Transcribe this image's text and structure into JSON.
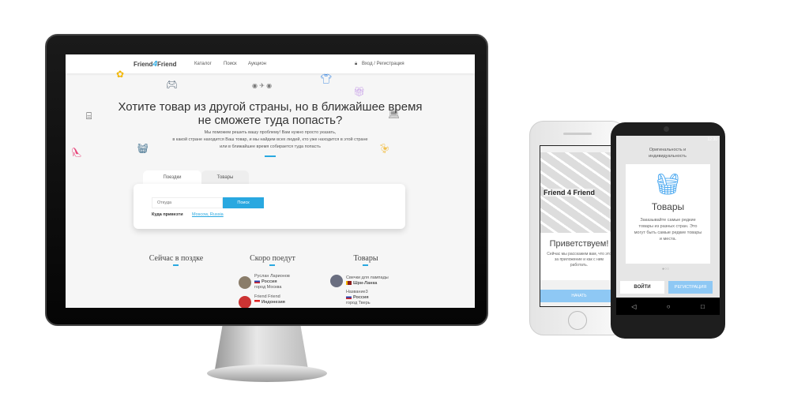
{
  "site": {
    "logo": {
      "left": "Friend",
      "mid": "4",
      "right": "Friend"
    },
    "nav": [
      "Каталог",
      "Поиск",
      "Аукцион"
    ],
    "login": "Вход / Регистрация",
    "hero_title_line1": "Хотите товар из другой страны, но в ближайшее время",
    "hero_title_line2": "не сможете туда попасть?",
    "hero_sub": [
      "Мы поможем решить вашу проблему! Вам нужно просто указать,",
      "в какой стране находится Ваш товар, и мы найдем всех людей, кто уже находится в этой стране",
      "или в ближайшее время собирается туда попасть"
    ],
    "tabs": [
      "Поездки",
      "Товары"
    ],
    "search": {
      "placeholder": "Откуда",
      "button": "Поиск",
      "dest_label": "Куда привезти",
      "dest_value": "Moscow, Russia"
    },
    "sections": [
      "Сейчас в поздке",
      "Скоро поедут",
      "Товары"
    ],
    "soon": [
      {
        "name": "Руслан Ларионов",
        "country": "Россия",
        "city": "город Москва"
      },
      {
        "name": "Friend Friend",
        "country": "Индонезия"
      }
    ],
    "goods": [
      {
        "name": "Свечки для лампады",
        "country": "Шри-Ланка"
      },
      {
        "name": "Название3",
        "country": "Россия",
        "city": "город Тверь"
      }
    ],
    "accent": "#29a8e0"
  },
  "iphone": {
    "logo": "Friend 4 Friend",
    "title": "Приветствуем!",
    "text": "Сейчас мы расскажем вам, что это за приложение и как с ним работать.",
    "button": "НАЧАТЬ"
  },
  "android": {
    "time": "12:30",
    "header": "Оригинальность и индивидуальность",
    "title": "Товары",
    "text": "Заказывайте самые редкие товары из разных стран. Это могут быть самые редкие товары и места.",
    "login": "ВОЙТИ",
    "register": "РЕГИСТРАЦИЯ",
    "nav": [
      "◁",
      "○",
      "□"
    ]
  }
}
